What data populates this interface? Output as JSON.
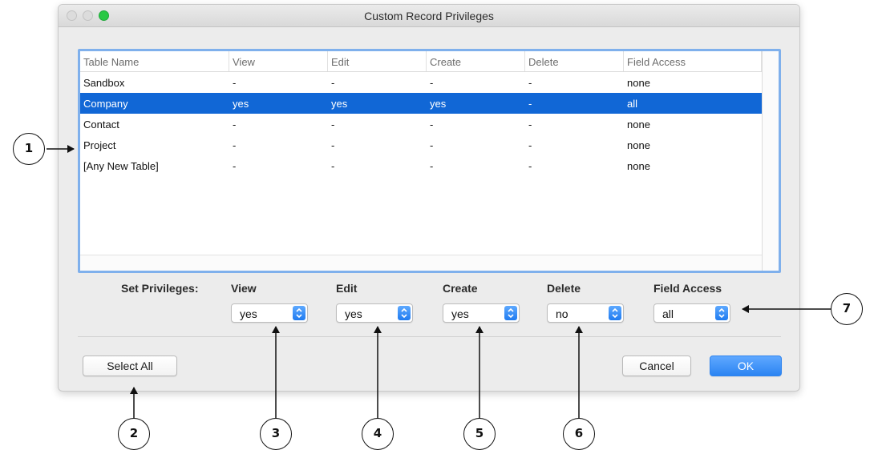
{
  "window": {
    "title": "Custom Record Privileges"
  },
  "table": {
    "columns": [
      "Table Name",
      "View",
      "Edit",
      "Create",
      "Delete",
      "Field Access"
    ],
    "rows": [
      {
        "name": "Sandbox",
        "view": "-",
        "edit": "-",
        "create": "-",
        "delete": "-",
        "field_access": "none",
        "selected": false
      },
      {
        "name": "Company",
        "view": "yes",
        "edit": "yes",
        "create": "yes",
        "delete": "-",
        "field_access": "all",
        "selected": true
      },
      {
        "name": "Contact",
        "view": "-",
        "edit": "-",
        "create": "-",
        "delete": "-",
        "field_access": "none",
        "selected": false
      },
      {
        "name": "Project",
        "view": "-",
        "edit": "-",
        "create": "-",
        "delete": "-",
        "field_access": "none",
        "selected": false
      },
      {
        "name": "[Any New Table]",
        "view": "-",
        "edit": "-",
        "create": "-",
        "delete": "-",
        "field_access": "none",
        "selected": false
      }
    ]
  },
  "privileges": {
    "label": "Set Privileges:",
    "view": {
      "label": "View",
      "value": "yes"
    },
    "edit": {
      "label": "Edit",
      "value": "yes"
    },
    "create": {
      "label": "Create",
      "value": "yes"
    },
    "delete": {
      "label": "Delete",
      "value": "no"
    },
    "field_access": {
      "label": "Field Access",
      "value": "all"
    }
  },
  "buttons": {
    "select_all": "Select All",
    "cancel": "Cancel",
    "ok": "OK"
  },
  "callouts": [
    "1",
    "2",
    "3",
    "4",
    "5",
    "6",
    "7"
  ],
  "colors": {
    "selection": "#1167d6",
    "accent": "#2b84f2",
    "close": "#dcdcdc",
    "zoom": "#2ac845"
  },
  "icons": {
    "select_arrows": "chevron-up-down-icon"
  }
}
